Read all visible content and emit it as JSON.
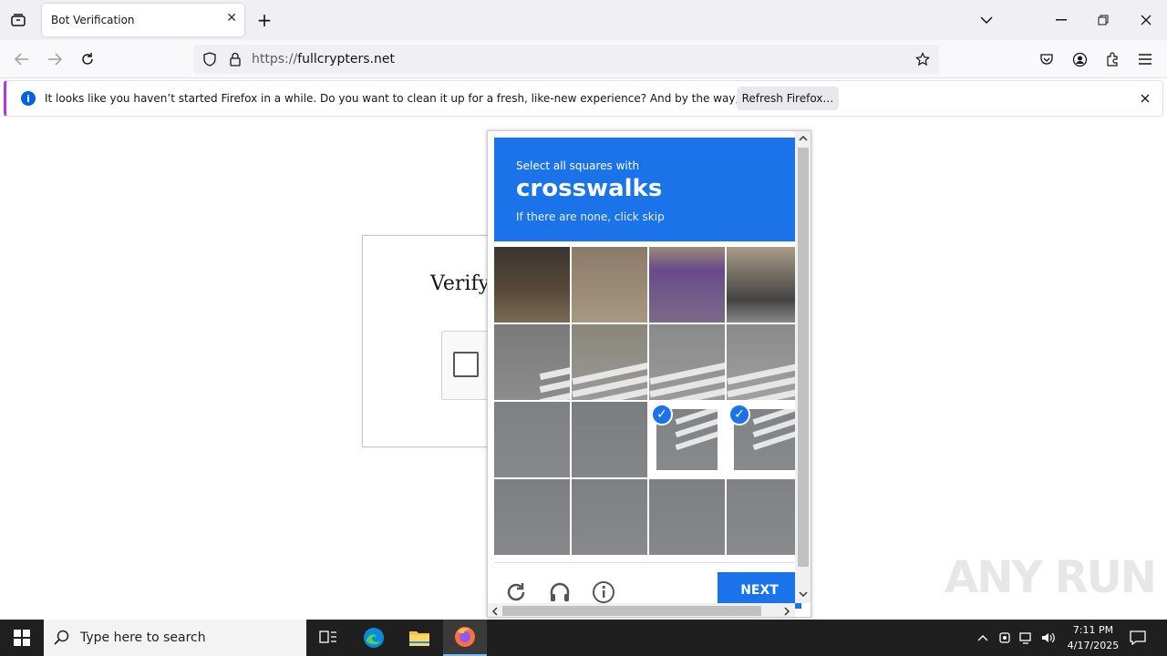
{
  "browser": {
    "tab_title": "Bot Verification",
    "url_scheme": "https://",
    "url_host": "fullcrypters.net"
  },
  "notification": {
    "message": "It looks like you haven’t started Firefox in a while. Do you want to clean it up for a fresh, like-new experience? And by the way, welcome back!",
    "button": "Refresh Firefox…"
  },
  "page": {
    "verify_title": "Verifyi"
  },
  "captcha": {
    "instruction": "Select all squares with",
    "target": "crosswalks",
    "sub": "If there are none, click skip",
    "next_label": "NEXT",
    "selected_tiles": [
      10,
      11
    ]
  },
  "taskbar": {
    "search_placeholder": "Type here to search",
    "time": "7:11 PM",
    "date": "4/17/2025"
  },
  "watermark": "ANY RUN",
  "colors": {
    "accent": "#1a73e8",
    "notification_accent": "#b833e1"
  }
}
